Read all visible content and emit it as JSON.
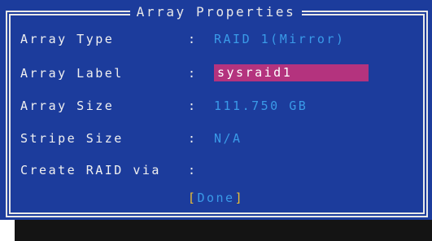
{
  "dialog": {
    "title": "Array Properties",
    "fields": [
      {
        "label": "Array Type",
        "colon": ":",
        "value": "RAID 1(Mirror)"
      },
      {
        "label": "Array Label",
        "colon": ":",
        "value": "sysraid1"
      },
      {
        "label": "Array Size",
        "colon": ":",
        "value": "111.750 GB"
      },
      {
        "label": "Stripe Size",
        "colon": ":",
        "value": "N/A"
      },
      {
        "label": "Create RAID via",
        "colon": ":",
        "value": ""
      }
    ],
    "done": {
      "open": "[",
      "label": "Done",
      "close": "]"
    }
  },
  "colors": {
    "background": "#1c3c9c",
    "label_text": "#f0f0f0",
    "value_text": "#3a9ae8",
    "selected_field": "#b4337e",
    "done_brackets": "#f0c030"
  }
}
